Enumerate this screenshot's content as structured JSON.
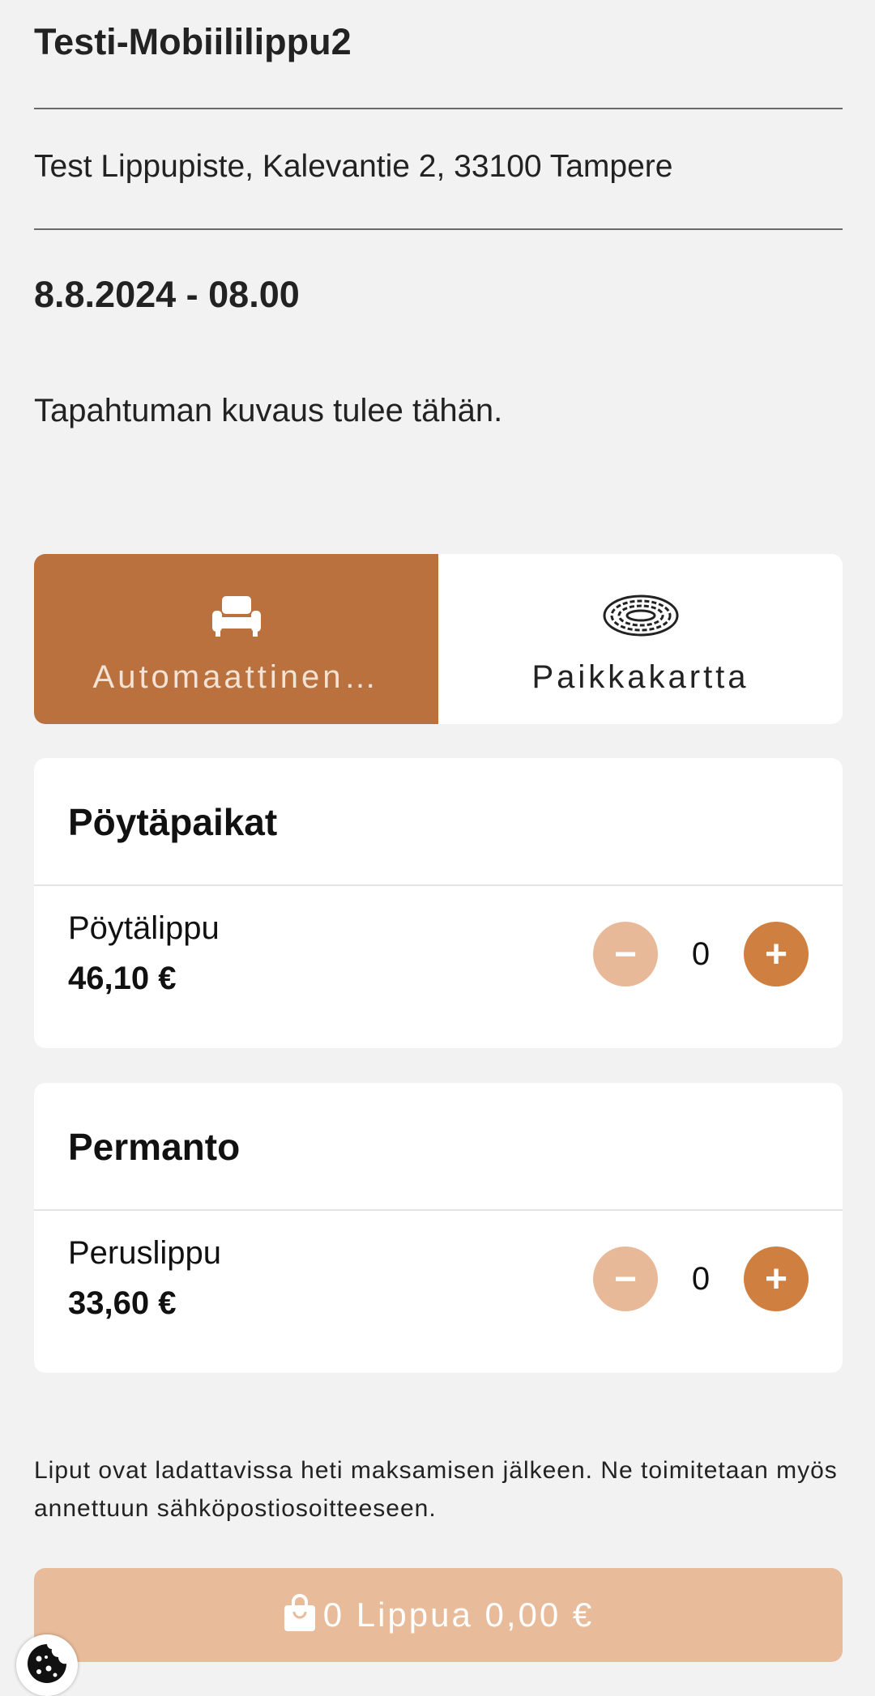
{
  "event": {
    "title": "Testi-Mobiililippu2",
    "venue": "Test Lippupiste, Kalevantie 2, 33100 Tampere",
    "datetime": "8.8.2024 - 08.00",
    "description": "Tapahtuman kuvaus tulee tähän."
  },
  "seat_mode": {
    "options": [
      {
        "label": "Automaattinen…",
        "icon": "armchair-icon",
        "active": true
      },
      {
        "label": "Paikkakartta",
        "icon": "stadium-icon",
        "active": false
      }
    ]
  },
  "sections": [
    {
      "title": "Pöytäpaikat",
      "tickets": [
        {
          "name": "Pöytälippu",
          "price": "46,10 €",
          "quantity": "0",
          "minus": "−",
          "plus": "+"
        }
      ]
    },
    {
      "title": "Permanto",
      "tickets": [
        {
          "name": "Peruslippu",
          "price": "33,60 €",
          "quantity": "0",
          "minus": "−",
          "plus": "+"
        }
      ]
    }
  ],
  "info_text": "Liput ovat ladattavissa heti maksamisen jälkeen. Ne toimitetaan myös annettuun sähköpostiosoitteeseen.",
  "cart": {
    "label": "0 Lippua 0,00 €",
    "icon": "shopping-bag-icon"
  },
  "cookie": {
    "icon": "cookie-icon"
  },
  "colors": {
    "accent": "#bb713d",
    "plus_button": "#cf7f40",
    "minus_button_disabled": "#e8b998",
    "cart_button_disabled": "#e8bc9a",
    "background": "#f2f2f2"
  }
}
